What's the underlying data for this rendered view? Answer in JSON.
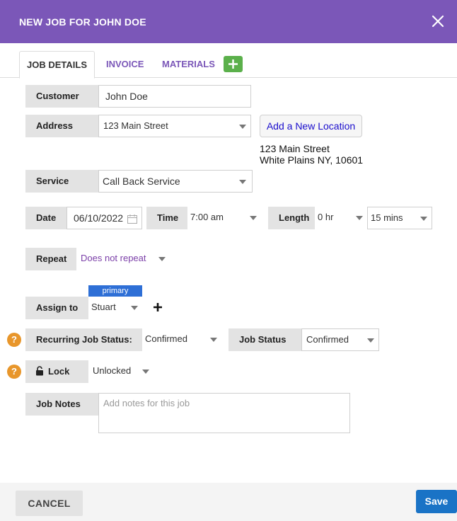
{
  "header": {
    "title": "NEW JOB FOR JOHN DOE"
  },
  "tabs": [
    {
      "label": "JOB DETAILS"
    },
    {
      "label": "INVOICE"
    },
    {
      "label": "MATERIALS"
    }
  ],
  "customer": {
    "label": "Customer",
    "value": "John Doe"
  },
  "address": {
    "label": "Address",
    "selected": "123 Main Street",
    "add_location_label": "Add a New Location",
    "line1": "123 Main Street",
    "line2": "White Plains NY, 10601"
  },
  "service": {
    "label": "Service",
    "selected": "Call Back Service"
  },
  "date": {
    "label": "Date",
    "value": "06/10/2022"
  },
  "time": {
    "label": "Time",
    "selected": "7:00 am"
  },
  "length": {
    "label": "Length",
    "hours": "0 hr",
    "minutes": "15 mins"
  },
  "repeat": {
    "label": "Repeat",
    "selected": "Does not repeat"
  },
  "assign": {
    "label": "Assign to",
    "badge": "primary",
    "selected": "Stuart"
  },
  "recurring_status": {
    "label": "Recurring Job Status:",
    "selected": "Confirmed"
  },
  "job_status": {
    "label": "Job Status",
    "selected": "Confirmed"
  },
  "lock": {
    "label": "Lock",
    "selected": "Unlocked"
  },
  "notes": {
    "label": "Job Notes",
    "placeholder": "Add notes for this job"
  },
  "footer": {
    "cancel_label": "CANCEL",
    "save_label": "Save"
  },
  "icons": {
    "close": "close-icon",
    "add_tab": "plus-icon",
    "calendar": "calendar-icon",
    "help": "question-icon",
    "lock": "lock-icon",
    "add_assignee": "plus-icon"
  },
  "colors": {
    "header_bg": "#7b57b8",
    "add_button": "#5bb04b",
    "primary_badge": "#2e6fd6",
    "help_icon": "#e8962b",
    "save_button": "#1a73c6",
    "link": "#1a0dcc"
  }
}
